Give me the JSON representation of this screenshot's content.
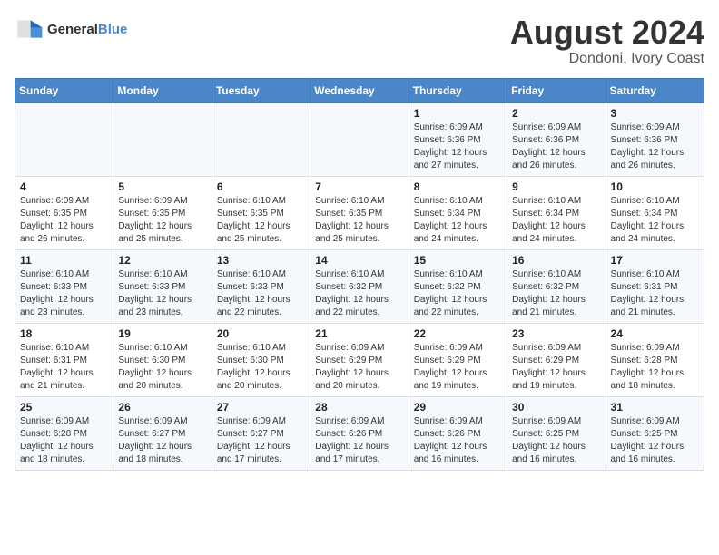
{
  "header": {
    "logo_line1": "General",
    "logo_line2": "Blue",
    "title": "August 2024",
    "subtitle": "Dondoni, Ivory Coast"
  },
  "calendar": {
    "days_of_week": [
      "Sunday",
      "Monday",
      "Tuesday",
      "Wednesday",
      "Thursday",
      "Friday",
      "Saturday"
    ],
    "weeks": [
      [
        {
          "day": "",
          "info": ""
        },
        {
          "day": "",
          "info": ""
        },
        {
          "day": "",
          "info": ""
        },
        {
          "day": "",
          "info": ""
        },
        {
          "day": "1",
          "info": "Sunrise: 6:09 AM\nSunset: 6:36 PM\nDaylight: 12 hours\nand 27 minutes."
        },
        {
          "day": "2",
          "info": "Sunrise: 6:09 AM\nSunset: 6:36 PM\nDaylight: 12 hours\nand 26 minutes."
        },
        {
          "day": "3",
          "info": "Sunrise: 6:09 AM\nSunset: 6:36 PM\nDaylight: 12 hours\nand 26 minutes."
        }
      ],
      [
        {
          "day": "4",
          "info": "Sunrise: 6:09 AM\nSunset: 6:35 PM\nDaylight: 12 hours\nand 26 minutes."
        },
        {
          "day": "5",
          "info": "Sunrise: 6:09 AM\nSunset: 6:35 PM\nDaylight: 12 hours\nand 25 minutes."
        },
        {
          "day": "6",
          "info": "Sunrise: 6:10 AM\nSunset: 6:35 PM\nDaylight: 12 hours\nand 25 minutes."
        },
        {
          "day": "7",
          "info": "Sunrise: 6:10 AM\nSunset: 6:35 PM\nDaylight: 12 hours\nand 25 minutes."
        },
        {
          "day": "8",
          "info": "Sunrise: 6:10 AM\nSunset: 6:34 PM\nDaylight: 12 hours\nand 24 minutes."
        },
        {
          "day": "9",
          "info": "Sunrise: 6:10 AM\nSunset: 6:34 PM\nDaylight: 12 hours\nand 24 minutes."
        },
        {
          "day": "10",
          "info": "Sunrise: 6:10 AM\nSunset: 6:34 PM\nDaylight: 12 hours\nand 24 minutes."
        }
      ],
      [
        {
          "day": "11",
          "info": "Sunrise: 6:10 AM\nSunset: 6:33 PM\nDaylight: 12 hours\nand 23 minutes."
        },
        {
          "day": "12",
          "info": "Sunrise: 6:10 AM\nSunset: 6:33 PM\nDaylight: 12 hours\nand 23 minutes."
        },
        {
          "day": "13",
          "info": "Sunrise: 6:10 AM\nSunset: 6:33 PM\nDaylight: 12 hours\nand 22 minutes."
        },
        {
          "day": "14",
          "info": "Sunrise: 6:10 AM\nSunset: 6:32 PM\nDaylight: 12 hours\nand 22 minutes."
        },
        {
          "day": "15",
          "info": "Sunrise: 6:10 AM\nSunset: 6:32 PM\nDaylight: 12 hours\nand 22 minutes."
        },
        {
          "day": "16",
          "info": "Sunrise: 6:10 AM\nSunset: 6:32 PM\nDaylight: 12 hours\nand 21 minutes."
        },
        {
          "day": "17",
          "info": "Sunrise: 6:10 AM\nSunset: 6:31 PM\nDaylight: 12 hours\nand 21 minutes."
        }
      ],
      [
        {
          "day": "18",
          "info": "Sunrise: 6:10 AM\nSunset: 6:31 PM\nDaylight: 12 hours\nand 21 minutes."
        },
        {
          "day": "19",
          "info": "Sunrise: 6:10 AM\nSunset: 6:30 PM\nDaylight: 12 hours\nand 20 minutes."
        },
        {
          "day": "20",
          "info": "Sunrise: 6:10 AM\nSunset: 6:30 PM\nDaylight: 12 hours\nand 20 minutes."
        },
        {
          "day": "21",
          "info": "Sunrise: 6:09 AM\nSunset: 6:29 PM\nDaylight: 12 hours\nand 20 minutes."
        },
        {
          "day": "22",
          "info": "Sunrise: 6:09 AM\nSunset: 6:29 PM\nDaylight: 12 hours\nand 19 minutes."
        },
        {
          "day": "23",
          "info": "Sunrise: 6:09 AM\nSunset: 6:29 PM\nDaylight: 12 hours\nand 19 minutes."
        },
        {
          "day": "24",
          "info": "Sunrise: 6:09 AM\nSunset: 6:28 PM\nDaylight: 12 hours\nand 18 minutes."
        }
      ],
      [
        {
          "day": "25",
          "info": "Sunrise: 6:09 AM\nSunset: 6:28 PM\nDaylight: 12 hours\nand 18 minutes."
        },
        {
          "day": "26",
          "info": "Sunrise: 6:09 AM\nSunset: 6:27 PM\nDaylight: 12 hours\nand 18 minutes."
        },
        {
          "day": "27",
          "info": "Sunrise: 6:09 AM\nSunset: 6:27 PM\nDaylight: 12 hours\nand 17 minutes."
        },
        {
          "day": "28",
          "info": "Sunrise: 6:09 AM\nSunset: 6:26 PM\nDaylight: 12 hours\nand 17 minutes."
        },
        {
          "day": "29",
          "info": "Sunrise: 6:09 AM\nSunset: 6:26 PM\nDaylight: 12 hours\nand 16 minutes."
        },
        {
          "day": "30",
          "info": "Sunrise: 6:09 AM\nSunset: 6:25 PM\nDaylight: 12 hours\nand 16 minutes."
        },
        {
          "day": "31",
          "info": "Sunrise: 6:09 AM\nSunset: 6:25 PM\nDaylight: 12 hours\nand 16 minutes."
        }
      ]
    ]
  }
}
